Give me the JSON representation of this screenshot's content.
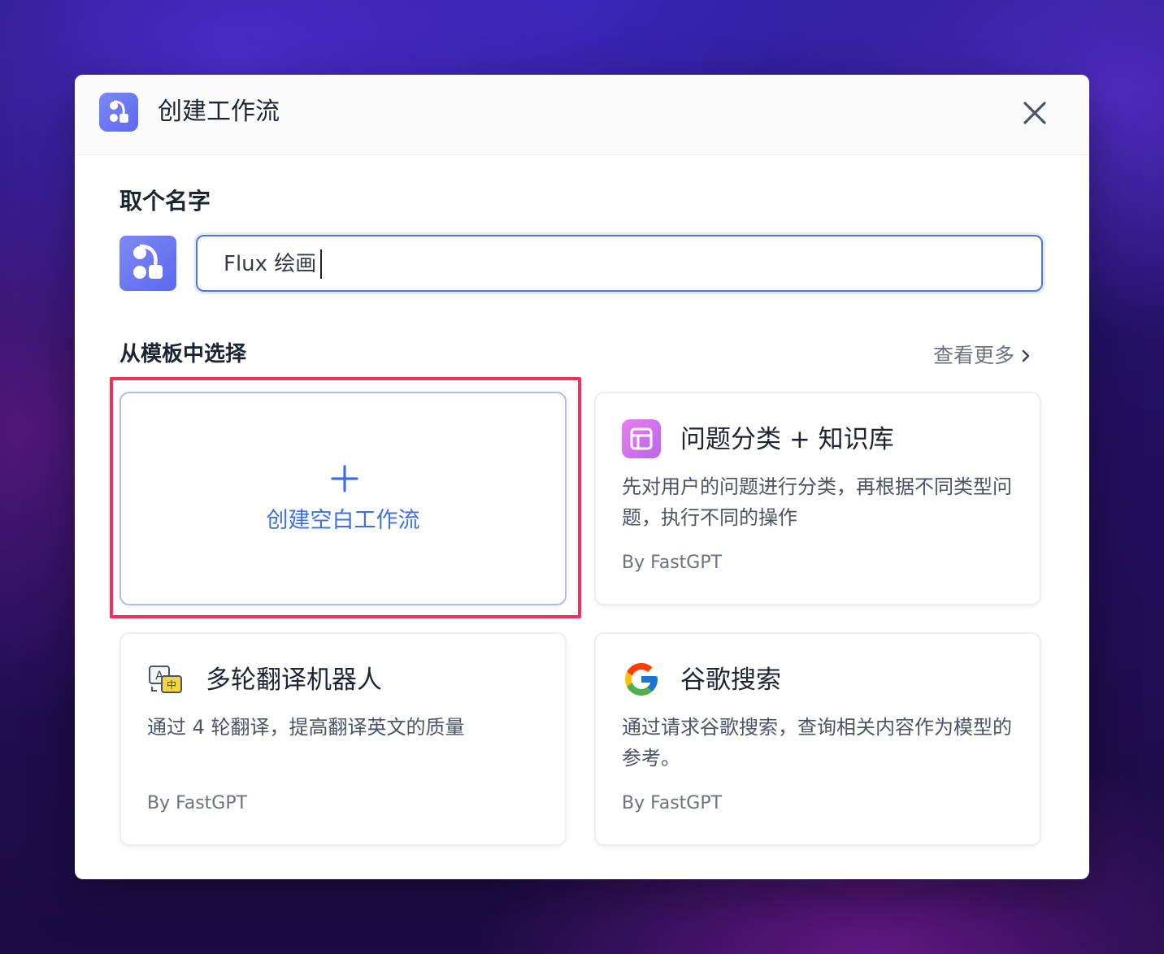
{
  "modal": {
    "title": "创建工作流",
    "name_section_label": "取个名字",
    "name_input_value": "Flux 绘画",
    "template_section_label": "从模板中选择",
    "more_link_label": "查看更多",
    "accent_color": "#4e74f0",
    "highlight_color": "#f0305a"
  },
  "templates": [
    {
      "type": "blank",
      "label": "创建空白工作流",
      "icon": "plus-icon"
    },
    {
      "title": "问题分类 + 知识库",
      "description": "先对用户的问题进行分类，再根据不同类型问题，执行不同的操作",
      "author": "By FastGPT",
      "icon": "layout-icon"
    },
    {
      "title": "多轮翻译机器人",
      "description": "通过 4 轮翻译，提高翻译英文的质量",
      "author": "By FastGPT",
      "icon": "translate-icon"
    },
    {
      "title": "谷歌搜索",
      "description": "通过请求谷歌搜索，查询相关内容作为模型的参考。",
      "author": "By FastGPT",
      "icon": "google-icon"
    }
  ]
}
